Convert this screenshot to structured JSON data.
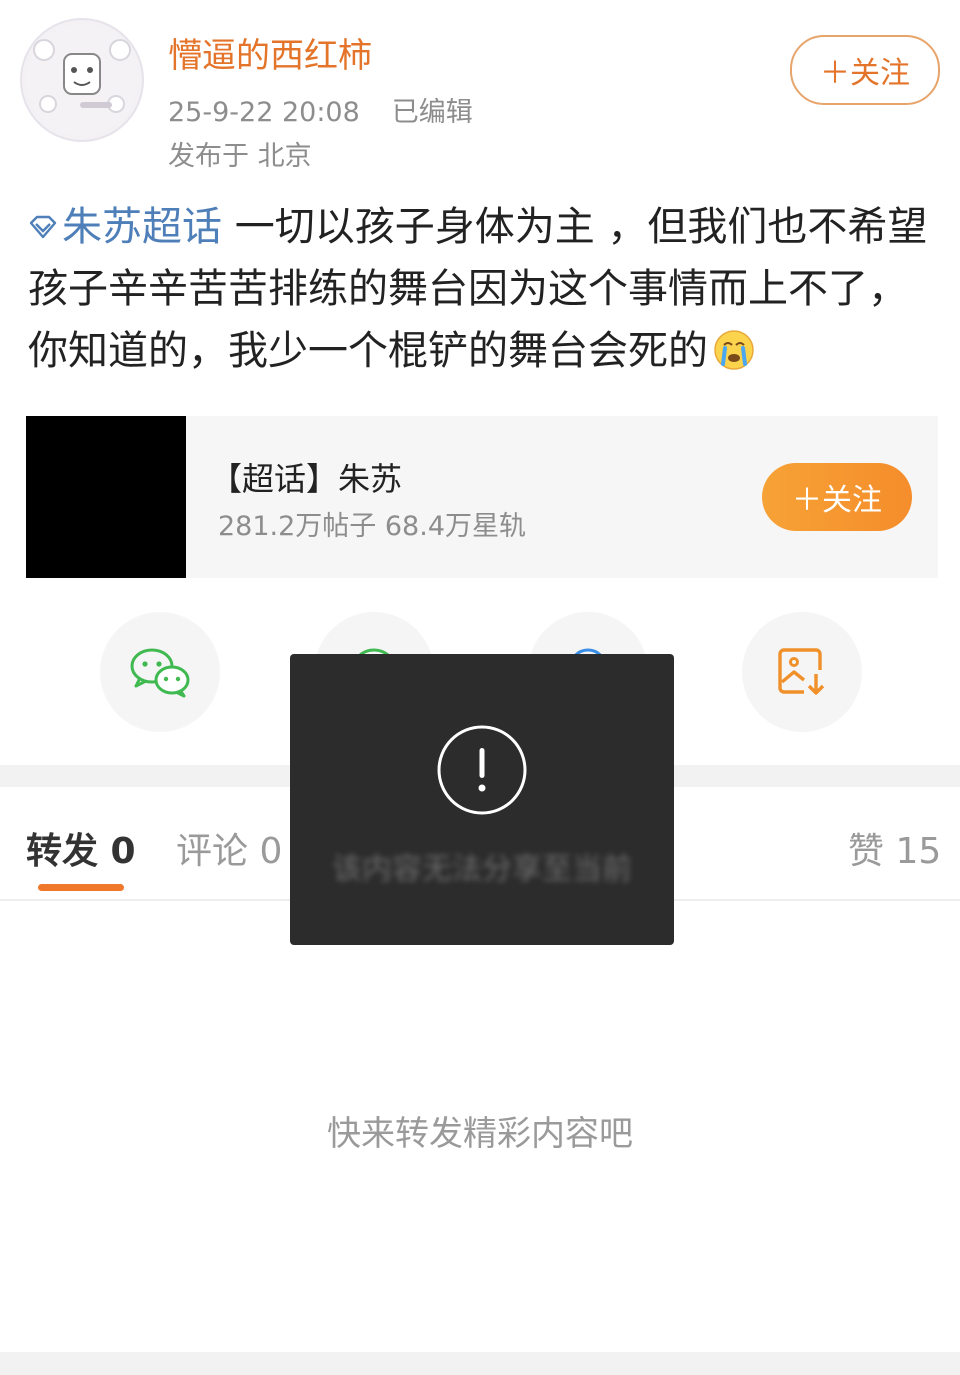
{
  "author": {
    "name": "懵逼的西红柿",
    "time": "25-9-22 20:08",
    "edited": "已编辑",
    "location": "发布于 北京",
    "follow_label": "＋关注"
  },
  "post": {
    "topic": "朱苏超话",
    "text": " 一切以孩子身体为主 ，但我们也不希望孩子辛辛苦苦排练的舞台因为这个事情而上不了，你知道的，我少一个棍铲的舞台会死的",
    "emoji": "crying-face-icon"
  },
  "supertopic": {
    "title": "【超话】朱苏",
    "stats": "281.2万帖子 68.4万星轨",
    "follow_label": "＋关注"
  },
  "share_icons": [
    "wechat-icon",
    "moments-icon",
    "qq-icon",
    "save-image-icon"
  ],
  "tabs": {
    "repost": "转发 0",
    "comment": "评论 0",
    "like": "赞 15"
  },
  "empty_state": "快来转发精彩内容吧",
  "toast": {
    "icon": "exclamation-icon",
    "message": "该内容无法分享至当前"
  },
  "colors": {
    "accent": "#e3742a",
    "topic": "#4e7fb8",
    "follow_gradient": "#f6a236"
  }
}
